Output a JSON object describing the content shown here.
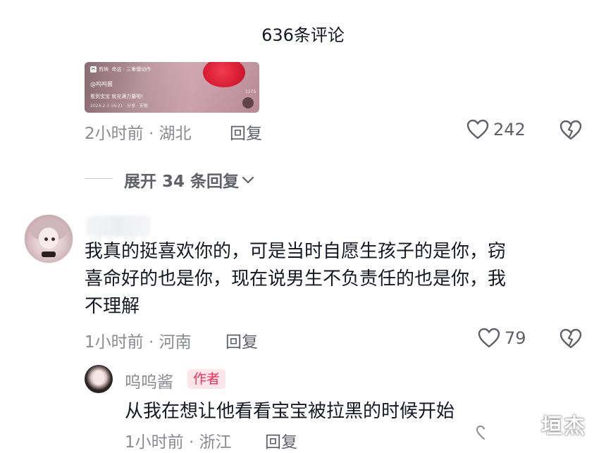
{
  "header": {
    "title": "636条评论"
  },
  "video_card": {
    "app_label": "剪映",
    "tags": "命运 · 三重慢动作",
    "author": "@呜呜酱",
    "caption": "看到宝宝 就充满力量啦!",
    "date_line": "2024-2-3 16:21 · 分享 · 安徽",
    "count": "1275"
  },
  "comment_1": {
    "meta": "2小时前 · 湖北",
    "reply_label": "回复",
    "likes": "242"
  },
  "expand": {
    "label": "展开 34 条回复"
  },
  "comment_2": {
    "text": "我真的挺喜欢你的，可是当时自愿生孩子的是你，窃\n喜命好的也是你，现在说男生不负责任的也是你，我\n不理解",
    "meta": "1小时前 · 河南",
    "reply_label": "回复",
    "likes": "79"
  },
  "reply_1": {
    "username": "呜呜酱",
    "badge": "作者",
    "text": "从我在想让他看看宝宝被拉黑的时候开始",
    "meta": "1小时前 · 浙江",
    "reply_label": "回复"
  },
  "watermark": "垣杰",
  "colors": {
    "primary_text": "#161823",
    "secondary_text": "#8a8b91",
    "accent": "#fe2c55",
    "badge_bg": "#fde6ea"
  },
  "icons": [
    "heart-icon",
    "dislike-heart-icon",
    "chevron-down-icon"
  ]
}
